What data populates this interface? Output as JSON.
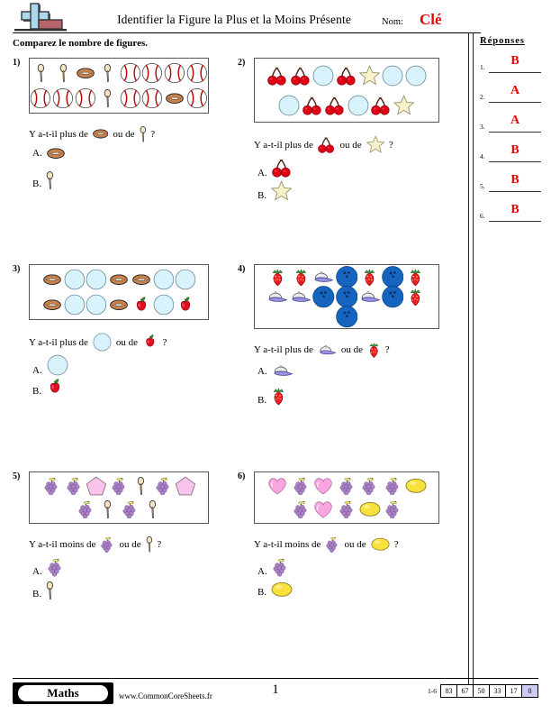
{
  "header": {
    "title": "Identifier la Figure la Plus et la Moins Présente",
    "name_label": "Nom:",
    "name_value": "Clé",
    "subtitle": "Comparez le nombre de figures.",
    "logo_icon": "plus-block-logo"
  },
  "answers_panel": {
    "heading": "Réponses",
    "rows": [
      {
        "num": "1.",
        "value": "B"
      },
      {
        "num": "2.",
        "value": "A"
      },
      {
        "num": "3.",
        "value": "A"
      },
      {
        "num": "4.",
        "value": "B"
      },
      {
        "num": "5.",
        "value": "B"
      },
      {
        "num": "6.",
        "value": "B"
      }
    ],
    "answer_color": "#ee0000"
  },
  "problems": [
    {
      "num": "1)",
      "question_pre": "Y a-t-il plus de",
      "question_mid": "ou de",
      "question_post": "?",
      "compare_a": "football",
      "compare_b": "spoon",
      "choices": [
        {
          "label": "A.",
          "icon": "football"
        },
        {
          "label": "B.",
          "icon": "spoon"
        }
      ],
      "grid": [
        [
          "spoon",
          "spoon",
          "football",
          "spoon",
          "baseball",
          "baseball",
          "baseball",
          "baseball"
        ],
        [
          "baseball",
          "baseball",
          "baseball",
          "spoon",
          "baseball",
          "baseball",
          "football",
          "baseball"
        ]
      ],
      "counts": {
        "football": 2,
        "spoon": 4,
        "baseball": 9
      }
    },
    {
      "num": "2)",
      "question_pre": "Y a-t-il plus de",
      "question_mid": "ou de",
      "question_post": "?",
      "compare_a": "cherries",
      "compare_b": "star",
      "choices": [
        {
          "label": "A.",
          "icon": "cherries"
        },
        {
          "label": "B.",
          "icon": "star"
        }
      ],
      "grid": [
        [
          "cherries",
          "cherries",
          "circle",
          "cherries",
          "star",
          "circle",
          "circle"
        ],
        [
          "circle",
          "cherries",
          "cherries",
          "circle",
          "cherries",
          "star"
        ]
      ],
      "counts": {
        "cherries": 6,
        "star": 2,
        "circle": 5
      }
    },
    {
      "num": "3)",
      "question_pre": "Y a-t-il plus de",
      "question_mid": "ou de",
      "question_post": "?",
      "compare_a": "circle",
      "compare_b": "apple",
      "choices": [
        {
          "label": "A.",
          "icon": "circle"
        },
        {
          "label": "B.",
          "icon": "apple"
        }
      ],
      "grid": [
        [
          "football",
          "circle",
          "circle",
          "football",
          "football",
          "circle",
          "circle"
        ],
        [
          "football",
          "circle",
          "circle",
          "football",
          "apple",
          "circle",
          "apple"
        ]
      ],
      "counts": {
        "circle": 7,
        "apple": 2,
        "football": 5
      }
    },
    {
      "num": "4)",
      "question_pre": "Y a-t-il plus de",
      "question_mid": "ou de",
      "question_post": "?",
      "compare_a": "cap",
      "compare_b": "strawberry",
      "choices": [
        {
          "label": "A.",
          "icon": "cap"
        },
        {
          "label": "B.",
          "icon": "strawberry"
        }
      ],
      "grid": [
        [
          "strawberry",
          "strawberry",
          "cap",
          "bowlingball",
          "strawberry",
          "bowlingball",
          "strawberry"
        ],
        [
          "cap",
          "cap",
          "bowlingball",
          "bowlingball",
          "cap",
          "bowlingball",
          "strawberry"
        ],
        [
          "bowlingball"
        ]
      ],
      "counts": {
        "cap": 4,
        "strawberry": 5,
        "bowlingball": 6
      }
    },
    {
      "num": "5)",
      "question_pre": "Y a-t-il moins de",
      "question_mid": "ou de",
      "question_post": "?",
      "compare_a": "grapes",
      "compare_b": "spoon",
      "choices": [
        {
          "label": "A.",
          "icon": "grapes"
        },
        {
          "label": "B.",
          "icon": "spoon"
        }
      ],
      "grid": [
        [
          "grapes",
          "grapes",
          "pentagon",
          "grapes",
          "spoon",
          "grapes",
          "pentagon"
        ],
        [
          "grapes",
          "spoon",
          "grapes",
          "spoon"
        ]
      ],
      "counts": {
        "grapes": 6,
        "spoon": 3,
        "pentagon": 2
      }
    },
    {
      "num": "6)",
      "question_pre": "Y a-t-il moins de",
      "question_mid": "ou de",
      "question_post": "?",
      "compare_a": "grapes",
      "compare_b": "lemon",
      "choices": [
        {
          "label": "A.",
          "icon": "grapes"
        },
        {
          "label": "B.",
          "icon": "lemon"
        }
      ],
      "grid": [
        [
          "heart",
          "grapes",
          "heart",
          "grapes",
          "grapes",
          "grapes",
          "lemon"
        ],
        [
          "grapes",
          "heart",
          "grapes",
          "lemon",
          "grapes"
        ]
      ],
      "counts": {
        "grapes": 6,
        "lemon": 2,
        "heart": 3
      }
    }
  ],
  "footer": {
    "subject": "Maths",
    "website": "www.CommonCoreSheets.fr",
    "page_number": "1",
    "scale_label": "1-6",
    "scale_values": [
      "83",
      "67",
      "50",
      "33",
      "17",
      "0"
    ],
    "scale_highlight_index": 5
  }
}
